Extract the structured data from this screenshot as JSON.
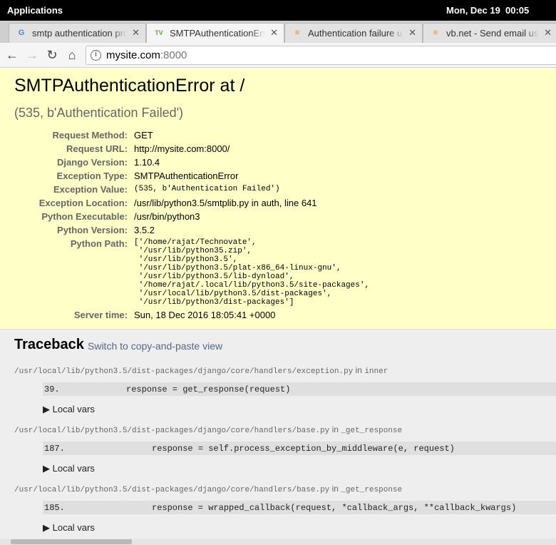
{
  "system_bar": {
    "applications": "Applications",
    "date": "Mon, Dec 19",
    "time": "00:05"
  },
  "tabs": [
    {
      "title": "smtp authentication pro",
      "favicon": "G"
    },
    {
      "title": "SMTPAuthenticationErro",
      "favicon": "TV"
    },
    {
      "title": "Authentication failure u",
      "favicon": "≡"
    },
    {
      "title": "vb.net - Send email usin",
      "favicon": "≡"
    }
  ],
  "address_bar": {
    "host": "mysite.com",
    "port": ":8000"
  },
  "error": {
    "title": "SMTPAuthenticationError at /",
    "subtitle": "(535, b'Authentication Failed')",
    "meta": [
      {
        "key": "Request Method:",
        "value": "GET"
      },
      {
        "key": "Request URL:",
        "value": "http://mysite.com:8000/"
      },
      {
        "key": "Django Version:",
        "value": "1.10.4"
      },
      {
        "key": "Exception Type:",
        "value": "SMTPAuthenticationError"
      },
      {
        "key": "Exception Value:",
        "value": "(535, b'Authentication Failed')"
      },
      {
        "key": "Exception Location:",
        "value": "/usr/lib/python3.5/smtplib.py in auth, line 641"
      },
      {
        "key": "Python Executable:",
        "value": "/usr/bin/python3"
      },
      {
        "key": "Python Version:",
        "value": "3.5.2"
      },
      {
        "key": "Python Path:",
        "value": "['/home/rajat/Technovate',\n '/usr/lib/python35.zip',\n '/usr/lib/python3.5',\n '/usr/lib/python3.5/plat-x86_64-linux-gnu',\n '/usr/lib/python3.5/lib-dynload',\n '/home/rajat/.local/lib/python3.5/site-packages',\n '/usr/local/lib/python3.5/dist-packages',\n '/usr/lib/python3/dist-packages']"
      },
      {
        "key": "Server time:",
        "value": "Sun, 18 Dec 2016 18:05:41 +0000"
      }
    ]
  },
  "traceback": {
    "title": "Traceback",
    "switch_link": "Switch to copy-and-paste view",
    "in_word": "in",
    "local_vars": "▶ Local vars",
    "frames": [
      {
        "file": "/usr/local/lib/python3.5/dist-packages/django/core/handlers/exception.py",
        "function": "inner",
        "line_no": "39.",
        "code": "response = get_response(request)"
      },
      {
        "file": "/usr/local/lib/python3.5/dist-packages/django/core/handlers/base.py",
        "function": "_get_response",
        "line_no": "187.",
        "code": "response = self.process_exception_by_middleware(e, request)"
      },
      {
        "file": "/usr/local/lib/python3.5/dist-packages/django/core/handlers/base.py",
        "function": "_get_response",
        "line_no": "185.",
        "code": "response = wrapped_callback(request, *callback_args, **callback_kwargs)"
      }
    ]
  },
  "icons": {
    "back": "arrow-left",
    "forward": "arrow-right",
    "reload": "reload",
    "home": "home",
    "info": "info",
    "close": "close"
  }
}
